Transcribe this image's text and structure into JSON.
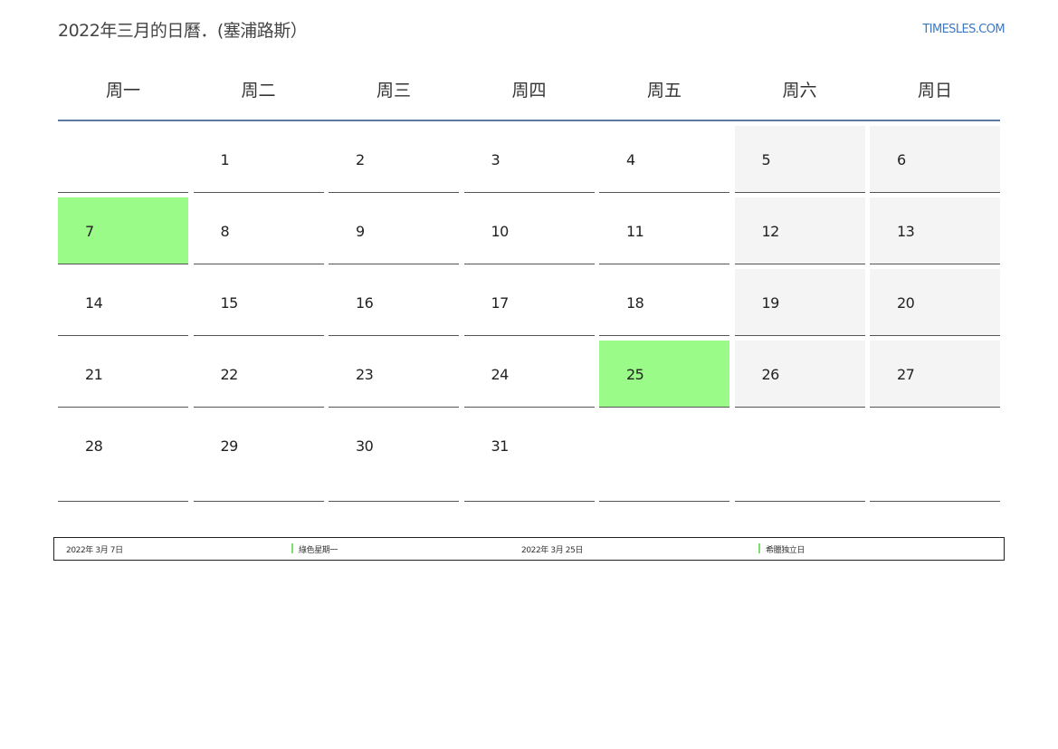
{
  "title": "2022年三月的日曆．(塞浦路斯）",
  "brand": "TIMESLES.COM",
  "weekdays": [
    "周一",
    "周二",
    "周三",
    "周四",
    "周五",
    "周六",
    "周日"
  ],
  "weeks": [
    [
      "",
      "1",
      "2",
      "3",
      "4",
      "5",
      "6"
    ],
    [
      "7",
      "8",
      "9",
      "10",
      "11",
      "12",
      "13"
    ],
    [
      "14",
      "15",
      "16",
      "17",
      "18",
      "19",
      "20"
    ],
    [
      "21",
      "22",
      "23",
      "24",
      "25",
      "26",
      "27"
    ],
    [
      "28",
      "29",
      "30",
      "31",
      "",
      "",
      ""
    ]
  ],
  "holiday_highlight_color": "#9afb88",
  "weekend_color": "#f4f4f4",
  "legend": [
    {
      "date": "2022年 3月 7日",
      "name": "綠色星期一"
    },
    {
      "date": "2022年 3月 25日",
      "name": "希臘独立日"
    }
  ]
}
